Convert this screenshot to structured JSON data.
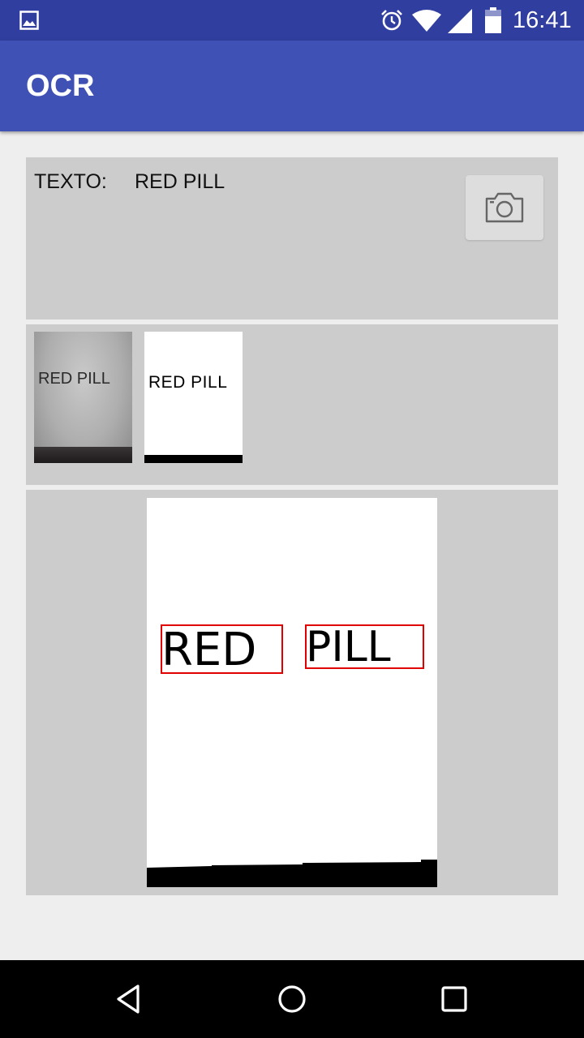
{
  "status_bar": {
    "time": "16:41",
    "icons": [
      "image-notification-icon",
      "alarm-icon",
      "wifi-icon",
      "cell-signal-icon",
      "battery-icon"
    ]
  },
  "app_bar": {
    "title": "OCR",
    "color": "#3f51b5",
    "status_color": "#303f9f"
  },
  "result": {
    "label": "TEXTO:",
    "value": "RED PILL",
    "camera_icon": "camera-icon"
  },
  "thumbnails": {
    "original_text": "RED PILL",
    "binarized_text": "RED PILL"
  },
  "detection": {
    "words": [
      "RED",
      "PILL"
    ],
    "box_color": "#e00000"
  },
  "nav_bar": {
    "icons": [
      "back-icon",
      "home-icon",
      "recents-icon"
    ]
  }
}
